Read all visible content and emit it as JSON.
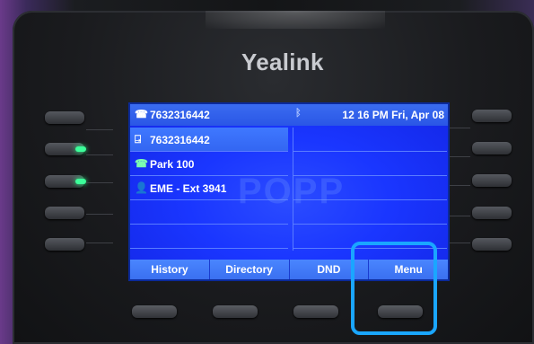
{
  "brand": "Yealink",
  "status_bar": {
    "phone_icon": "phone-icon",
    "number": "7632316442",
    "bluetooth_icon": "bluetooth-icon",
    "datetime": "12 16 PM Fri, Apr 08"
  },
  "lines": [
    {
      "icon": "line-register-icon",
      "glyph": "⍈",
      "label": "7632316442",
      "selected": true
    },
    {
      "icon": "park-call-icon",
      "glyph": "☎",
      "label": "Park 100",
      "selected": false
    },
    {
      "icon": "contact-icon",
      "glyph": "👤",
      "label": "EME - Ext 3941",
      "selected": false
    }
  ],
  "watermark": "POPP",
  "softkeys": [
    "History",
    "Directory",
    "DND",
    "Menu"
  ],
  "colors": {
    "screen": "#1a36ff",
    "highlight": "#1aa6ff",
    "led": "#3cff9a"
  }
}
